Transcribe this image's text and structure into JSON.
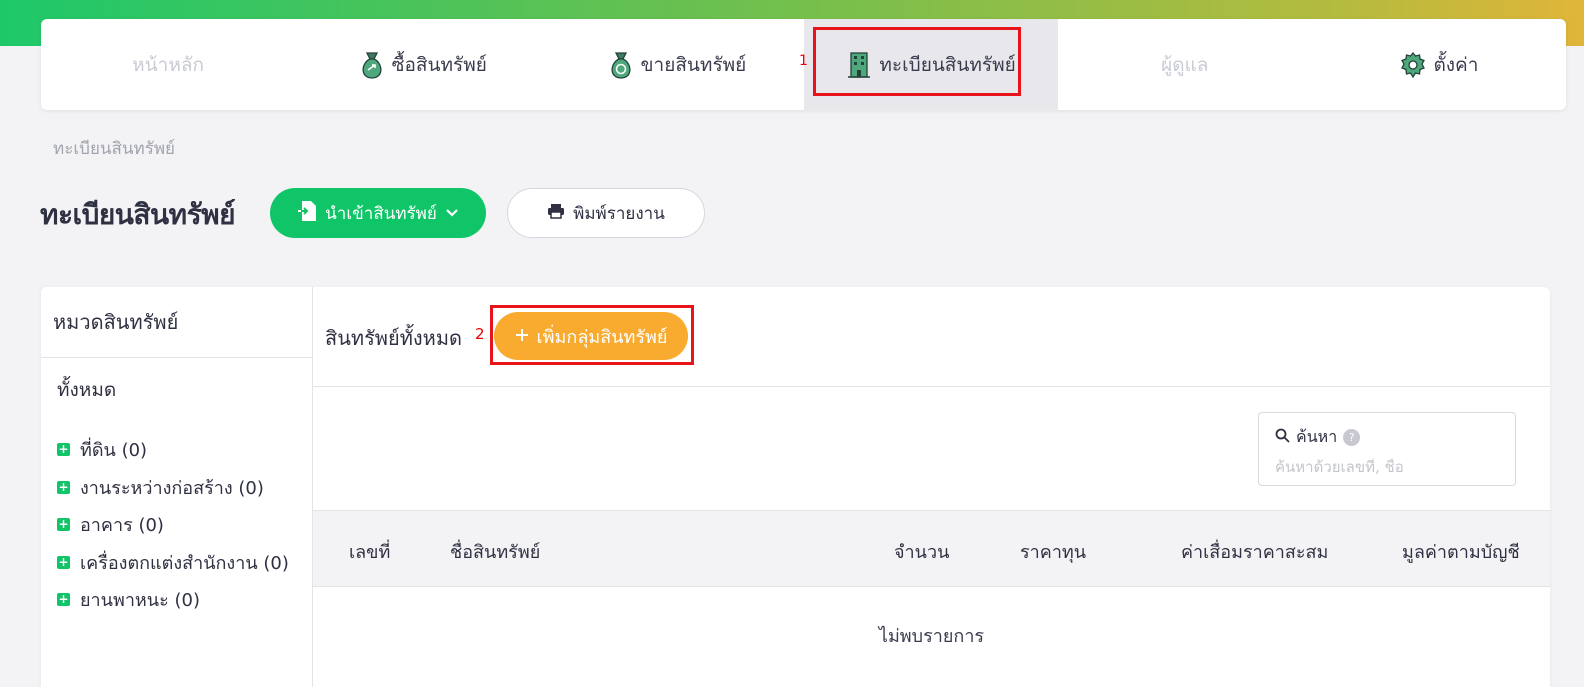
{
  "nav": {
    "items": [
      {
        "label": "หน้าหลัก",
        "icon": "home"
      },
      {
        "label": "ซื้อสินทรัพย์",
        "icon": "money-bag-icon"
      },
      {
        "label": "ขายสินทรัพย์",
        "icon": "money-bag-icon"
      },
      {
        "label": "ทะเบียนสินทรัพย์",
        "icon": "building-icon"
      },
      {
        "label": "ผู้ดูแล",
        "icon": "user"
      },
      {
        "label": "ตั้งค่า",
        "icon": "gear-icon"
      }
    ],
    "step_marker": "1"
  },
  "breadcrumb": "ทะเบียนสินทรัพย์",
  "page_title": "ทะเบียนสินทรัพย์",
  "toolbar": {
    "import_label": "นำเข้าสินทรัพย์",
    "print_label": "พิมพ์รายงาน"
  },
  "sidebar": {
    "title": "หมวดสินทรัพย์",
    "all_label": "ทั้งหมด",
    "categories": [
      "ที่ดิน (0)",
      "งานระหว่างก่อสร้าง (0)",
      "อาคาร (0)",
      "เครื่องตกแต่งสำนักงาน (0)",
      "ยานพาหนะ (0)"
    ]
  },
  "main": {
    "title": "สินทรัพย์ทั้งหมด",
    "step_marker": "2",
    "add_group_label": "เพิ่มกลุ่มสินทรัพย์",
    "search_label": "ค้นหา",
    "search_placeholder": "ค้นหาด้วยเลขที่, ชื่อ",
    "columns": [
      "เลขที่",
      "ชื่อสินทรัพย์",
      "จำนวน",
      "ราคาทุน",
      "ค่าเสื่อมราคาสะสม",
      "มูลค่าตามบัญชี"
    ],
    "empty_text": "ไม่พบรายการ"
  },
  "colors": {
    "primary_green": "#0fc567",
    "accent_orange": "#f8ab2f",
    "highlight_red": "#e8141c"
  }
}
